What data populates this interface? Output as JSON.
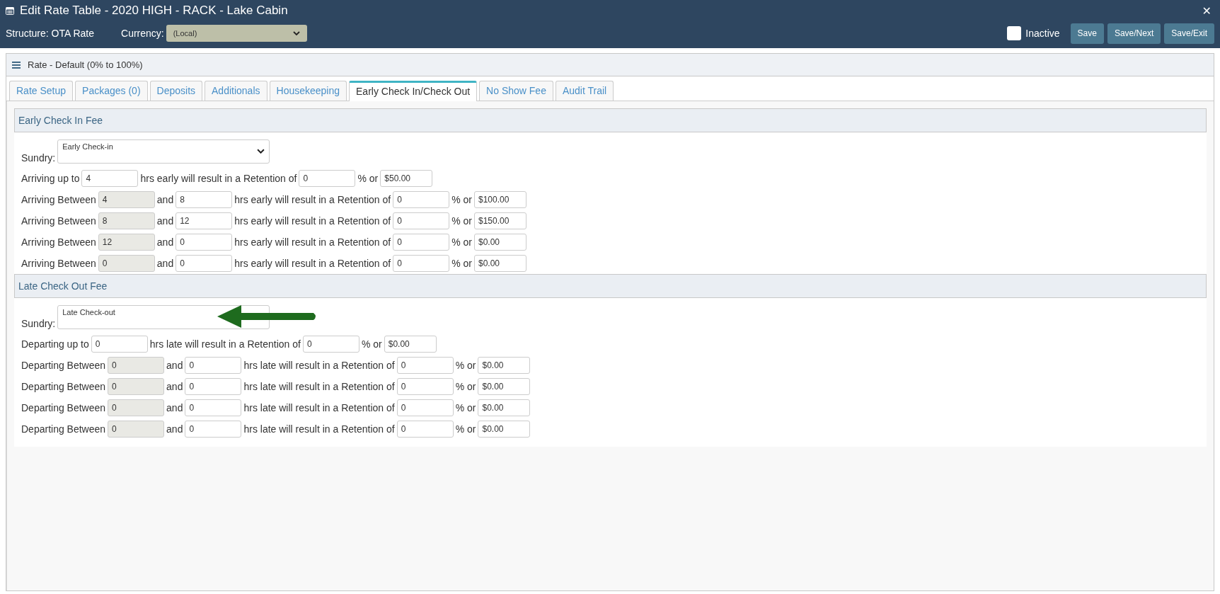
{
  "window": {
    "title": "Edit Rate Table - 2020 HIGH - RACK - Lake Cabin",
    "close": "✕"
  },
  "toolbar": {
    "structure": "Structure: OTA Rate",
    "currency_label": "Currency:",
    "currency_value": "(Local)",
    "inactive": {
      "label": "Inactive",
      "checked": false
    },
    "buttons": [
      "Save",
      "Save/Next",
      "Save/Exit"
    ]
  },
  "panel": {
    "title": "Rate - Default (0% to 100%)"
  },
  "tabs": [
    {
      "label": "Rate Setup",
      "selected": false
    },
    {
      "label": "Packages (0)",
      "selected": false
    },
    {
      "label": "Deposits",
      "selected": false
    },
    {
      "label": "Additionals",
      "selected": false
    },
    {
      "label": "Housekeeping",
      "selected": false
    },
    {
      "label": "Early Check In/Check Out",
      "selected": true
    },
    {
      "label": "No Show Fee",
      "selected": false
    },
    {
      "label": "Audit Trail",
      "selected": false
    }
  ],
  "sections": [
    {
      "title": "Early Check In Fee",
      "sundry": {
        "label": "Sundry:",
        "value": "Early Check-in",
        "dropdown": true,
        "pointer": false
      },
      "rows": [
        {
          "kind": "up_to",
          "lead": "Arriving up to",
          "from": {
            "value": "4",
            "disabled": false
          },
          "middle": "hrs early will result in a Retention of",
          "percent": "0",
          "percent_label": "% or",
          "amount": "$50.00"
        },
        {
          "kind": "between",
          "lead": "Arriving Between",
          "from": {
            "value": "4",
            "disabled": true
          },
          "and": "and",
          "to": "8",
          "middle": "hrs early will result in a Retention of",
          "percent": "0",
          "percent_label": "% or",
          "amount": "$100.00"
        },
        {
          "kind": "between",
          "lead": "Arriving Between",
          "from": {
            "value": "8",
            "disabled": true
          },
          "and": "and",
          "to": "12",
          "middle": "hrs early will result in a Retention of",
          "percent": "0",
          "percent_label": "% or",
          "amount": "$150.00"
        },
        {
          "kind": "between",
          "lead": "Arriving Between",
          "from": {
            "value": "12",
            "disabled": true
          },
          "and": "and",
          "to": "0",
          "middle": "hrs early will result in a Retention of",
          "percent": "0",
          "percent_label": "% or",
          "amount": "$0.00"
        },
        {
          "kind": "between",
          "lead": "Arriving Between",
          "from": {
            "value": "0",
            "disabled": true
          },
          "and": "and",
          "to": "0",
          "middle": "hrs early will result in a Retention of",
          "percent": "0",
          "percent_label": "% or",
          "amount": "$0.00"
        }
      ]
    },
    {
      "title": "Late Check Out Fee",
      "sundry": {
        "label": "Sundry:",
        "value": "Late Check-out",
        "dropdown": false,
        "pointer": true
      },
      "rows": [
        {
          "kind": "up_to",
          "lead": "Departing up to",
          "from": {
            "value": "0",
            "disabled": false
          },
          "middle": "hrs late will result in a Retention of",
          "percent": "0",
          "percent_label": "% or",
          "amount": "$0.00"
        },
        {
          "kind": "between",
          "lead": "Departing Between",
          "from": {
            "value": "0",
            "disabled": true
          },
          "and": "and",
          "to": "0",
          "middle": "hrs late will result in a Retention of",
          "percent": "0",
          "percent_label": "% or",
          "amount": "$0.00"
        },
        {
          "kind": "between",
          "lead": "Departing Between",
          "from": {
            "value": "0",
            "disabled": true
          },
          "and": "and",
          "to": "0",
          "middle": "hrs late will result in a Retention of",
          "percent": "0",
          "percent_label": "% or",
          "amount": "$0.00"
        },
        {
          "kind": "between",
          "lead": "Departing Between",
          "from": {
            "value": "0",
            "disabled": true
          },
          "and": "and",
          "to": "0",
          "middle": "hrs late will result in a Retention of",
          "percent": "0",
          "percent_label": "% or",
          "amount": "$0.00"
        },
        {
          "kind": "between",
          "lead": "Departing Between",
          "from": {
            "value": "0",
            "disabled": true
          },
          "and": "and",
          "to": "0",
          "middle": "hrs late will result in a Retention of",
          "percent": "0",
          "percent_label": "% or",
          "amount": "$0.00"
        }
      ]
    }
  ]
}
